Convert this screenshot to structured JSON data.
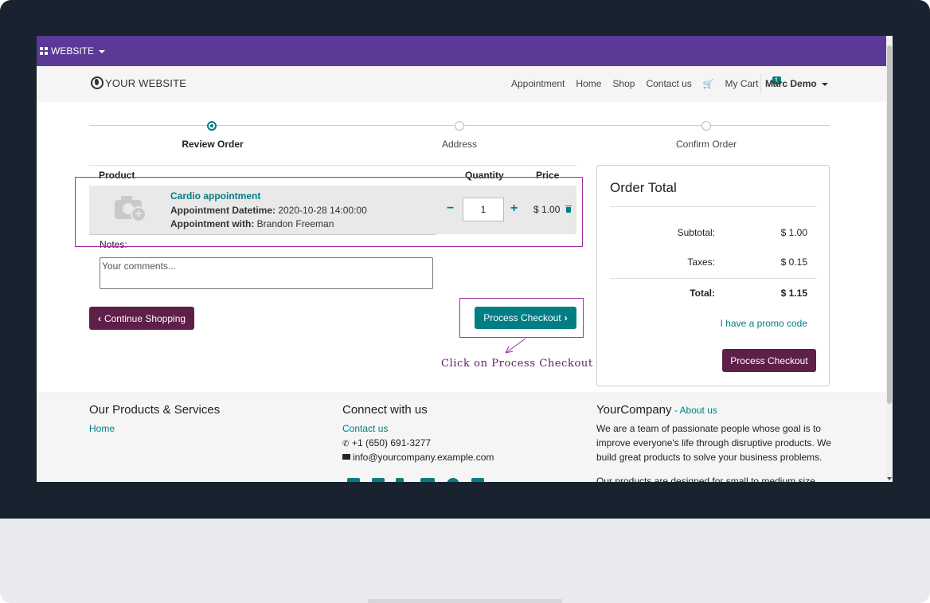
{
  "adminbar": {
    "label": "WEBSITE"
  },
  "navbar": {
    "brand": "YOUR WEBSITE",
    "links": [
      "Appointment",
      "Home",
      "Shop",
      "Contact us"
    ],
    "cart_label": "My Cart",
    "cart_count": "1",
    "user": "Marc Demo"
  },
  "steps": [
    "Review Order",
    "Address",
    "Confirm Order"
  ],
  "cart": {
    "headers": {
      "product": "Product",
      "quantity": "Quantity",
      "price": "Price"
    },
    "item": {
      "name": "Cardio appointment",
      "datetime_label": "Appointment Datetime:",
      "datetime_value": "2020-10-28 14:00:00",
      "with_label": "Appointment with:",
      "with_value": "Brandon Freeman",
      "quantity": "1",
      "price": "$ 1.00"
    },
    "notes_label": "Notes:",
    "notes_placeholder": "Your comments...",
    "continue_label": "Continue Shopping",
    "checkout_label": "Process Checkout"
  },
  "annotation": {
    "text": "Click on Process Checkout"
  },
  "order_total": {
    "title": "Order Total",
    "subtotal_label": "Subtotal:",
    "subtotal_value": "$ 1.00",
    "taxes_label": "Taxes:",
    "taxes_value": "$ 0.15",
    "total_label": "Total:",
    "total_value": "$ 1.15",
    "promo_label": "I have a promo code",
    "checkout_label": "Process Checkout"
  },
  "footer": {
    "col1": {
      "title": "Our Products & Services",
      "link": "Home"
    },
    "col2": {
      "title": "Connect with us",
      "contact": "Contact us",
      "phone": "+1 (650) 691-3277",
      "email": "info@yourcompany.example.com"
    },
    "col3": {
      "title": "YourCompany",
      "dash": " - ",
      "about": "About us",
      "line1": "We are a team of passionate people whose goal is to",
      "line2": "improve everyone's life through disruptive products. We",
      "line3": "build great products to solve your business problems.",
      "line4": "Our products are designed for small to medium size"
    }
  },
  "colors": {
    "admin": "#5b3996",
    "accent": "#017e84",
    "button_dark": "#5e1f49",
    "annotation": "#a12da6"
  }
}
